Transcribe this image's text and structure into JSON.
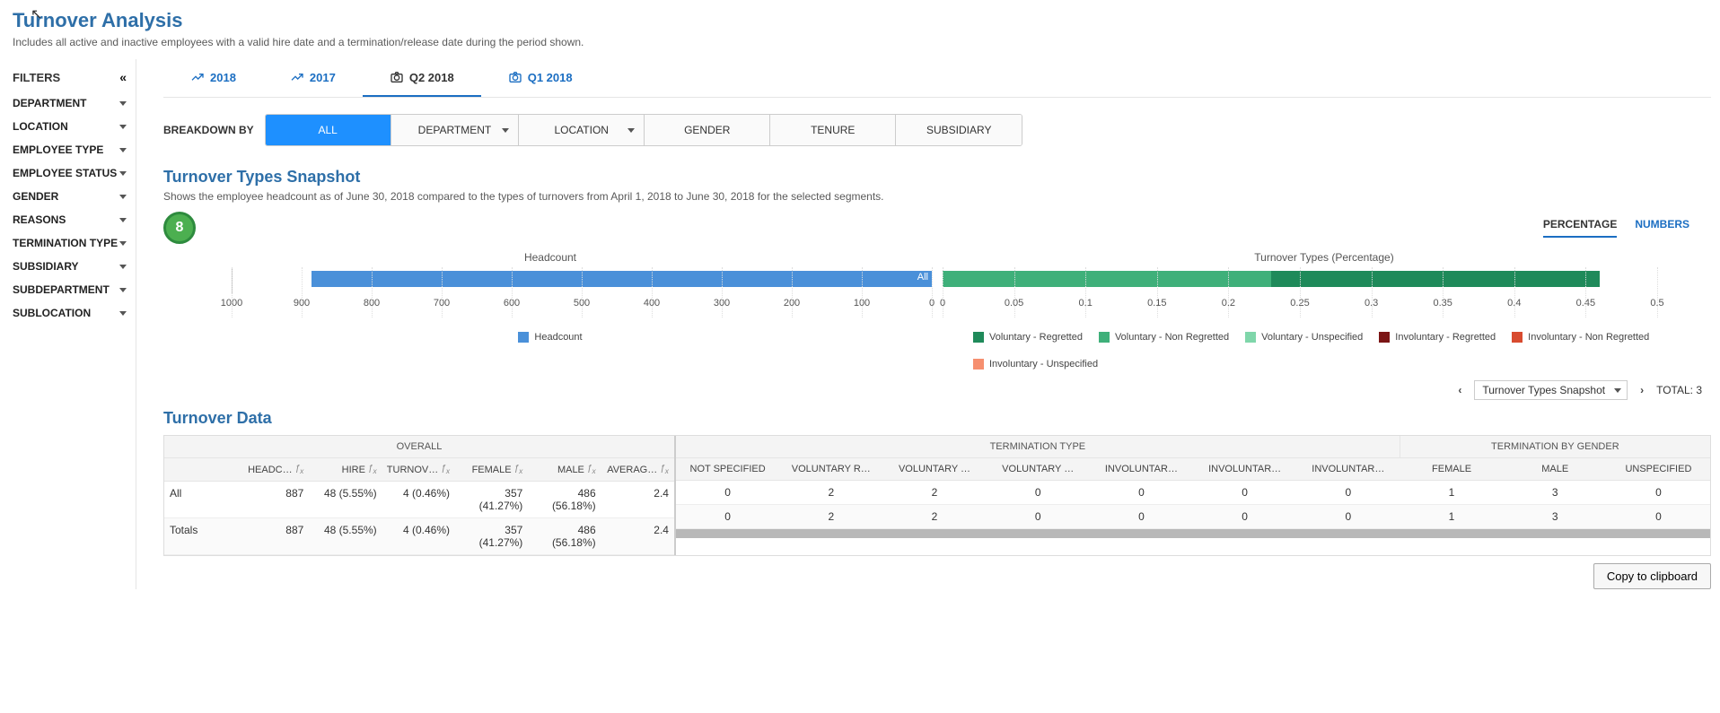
{
  "page": {
    "title": "Turnover Analysis",
    "subtitle": "Includes all active and inactive employees with a valid hire date and a termination/release date during the period shown."
  },
  "sidebar": {
    "filters_label": "FILTERS",
    "items": [
      {
        "label": "DEPARTMENT"
      },
      {
        "label": "LOCATION"
      },
      {
        "label": "EMPLOYEE TYPE"
      },
      {
        "label": "EMPLOYEE STATUS"
      },
      {
        "label": "GENDER"
      },
      {
        "label": "REASONS"
      },
      {
        "label": "TERMINATION TYPE"
      },
      {
        "label": "SUBSIDIARY"
      },
      {
        "label": "SUBDEPARTMENT"
      },
      {
        "label": "SUBLOCATION"
      }
    ]
  },
  "tabs": [
    {
      "label": "2018",
      "icon": "trend",
      "active": false
    },
    {
      "label": "2017",
      "icon": "trend",
      "active": false
    },
    {
      "label": "Q2 2018",
      "icon": "camera",
      "active": true
    },
    {
      "label": "Q1 2018",
      "icon": "camera",
      "active": false
    }
  ],
  "breakdown": {
    "label": "BREAKDOWN BY",
    "options": [
      {
        "label": "ALL",
        "active": true,
        "dropdown": false
      },
      {
        "label": "DEPARTMENT",
        "active": false,
        "dropdown": true
      },
      {
        "label": "LOCATION",
        "active": false,
        "dropdown": true
      },
      {
        "label": "GENDER",
        "active": false,
        "dropdown": false
      },
      {
        "label": "TENURE",
        "active": false,
        "dropdown": false
      },
      {
        "label": "SUBSIDIARY",
        "active": false,
        "dropdown": false
      }
    ]
  },
  "snapshot": {
    "title": "Turnover Types Snapshot",
    "desc": "Shows the employee headcount as of June 30, 2018 compared to the types of turnovers from April 1, 2018 to June 30, 2018 for the selected segments.",
    "badge": "8",
    "toggles": {
      "percentage": "PERCENTAGE",
      "numbers": "NUMBERS"
    },
    "left_title": "Headcount",
    "right_title": "Turnover Types (Percentage)",
    "left_legend": "Headcount",
    "right_legend": [
      {
        "label": "Voluntary - Regretted",
        "color": "#1f8a5a"
      },
      {
        "label": "Voluntary - Non Regretted",
        "color": "#3fb07a"
      },
      {
        "label": "Voluntary - Unspecified",
        "color": "#7fd6aa"
      },
      {
        "label": "Involuntary - Regretted",
        "color": "#7b1515"
      },
      {
        "label": "Involuntary - Non Regretted",
        "color": "#d84b2f"
      },
      {
        "label": "Involuntary - Unspecified",
        "color": "#f68f6f"
      }
    ]
  },
  "chart_data": {
    "left": {
      "type": "bar",
      "orientation": "horizontal-reversed",
      "categories": [
        "All"
      ],
      "values": [
        887
      ],
      "xlim": [
        0,
        1000
      ],
      "xticks": [
        1000,
        900,
        800,
        700,
        600,
        500,
        400,
        300,
        200,
        100,
        0
      ],
      "bar_label": "All"
    },
    "right": {
      "type": "stacked-bar",
      "orientation": "horizontal",
      "categories": [
        "All"
      ],
      "series": [
        {
          "name": "Voluntary - Regretted",
          "values": [
            0.23
          ],
          "color": "#3fb07a"
        },
        {
          "name": "Voluntary - Non Regretted",
          "values": [
            0.23
          ],
          "color": "#1f8a5a"
        }
      ],
      "xlim": [
        0,
        0.5
      ],
      "xticks": [
        0,
        0.05,
        0.1,
        0.15,
        0.2,
        0.25,
        0.3,
        0.35,
        0.4,
        0.45,
        0.5
      ]
    }
  },
  "pager": {
    "select_label": "Turnover Types Snapshot",
    "total_label": "TOTAL: 3"
  },
  "table": {
    "title": "Turnover Data",
    "groups": {
      "overall": "OVERALL",
      "term_type": "TERMINATION TYPE",
      "term_gender": "TERMINATION BY GENDER"
    },
    "left_cols": [
      "",
      "HEADC…",
      "HIRE",
      "TURNOV…",
      "FEMALE",
      "MALE",
      "AVERAG…"
    ],
    "right_cols": [
      "NOT SPECIFIED",
      "VOLUNTARY R…",
      "VOLUNTARY …",
      "VOLUNTARY …",
      "INVOLUNTAR…",
      "INVOLUNTAR…",
      "INVOLUNTAR…",
      "FEMALE",
      "MALE",
      "UNSPECIFIED"
    ],
    "rows": [
      {
        "label": "All",
        "left": [
          "887",
          "48 (5.55%)",
          "4 (0.46%)",
          "357 (41.27%)",
          "486 (56.18%)",
          "2.4"
        ],
        "right": [
          "0",
          "2",
          "2",
          "0",
          "0",
          "0",
          "0",
          "1",
          "3",
          "0"
        ]
      },
      {
        "label": "Totals",
        "left": [
          "887",
          "48 (5.55%)",
          "4 (0.46%)",
          "357 (41.27%)",
          "486 (56.18%)",
          "2.4"
        ],
        "right": [
          "0",
          "2",
          "2",
          "0",
          "0",
          "0",
          "0",
          "1",
          "3",
          "0"
        ]
      }
    ]
  },
  "buttons": {
    "copy": "Copy to clipboard"
  }
}
